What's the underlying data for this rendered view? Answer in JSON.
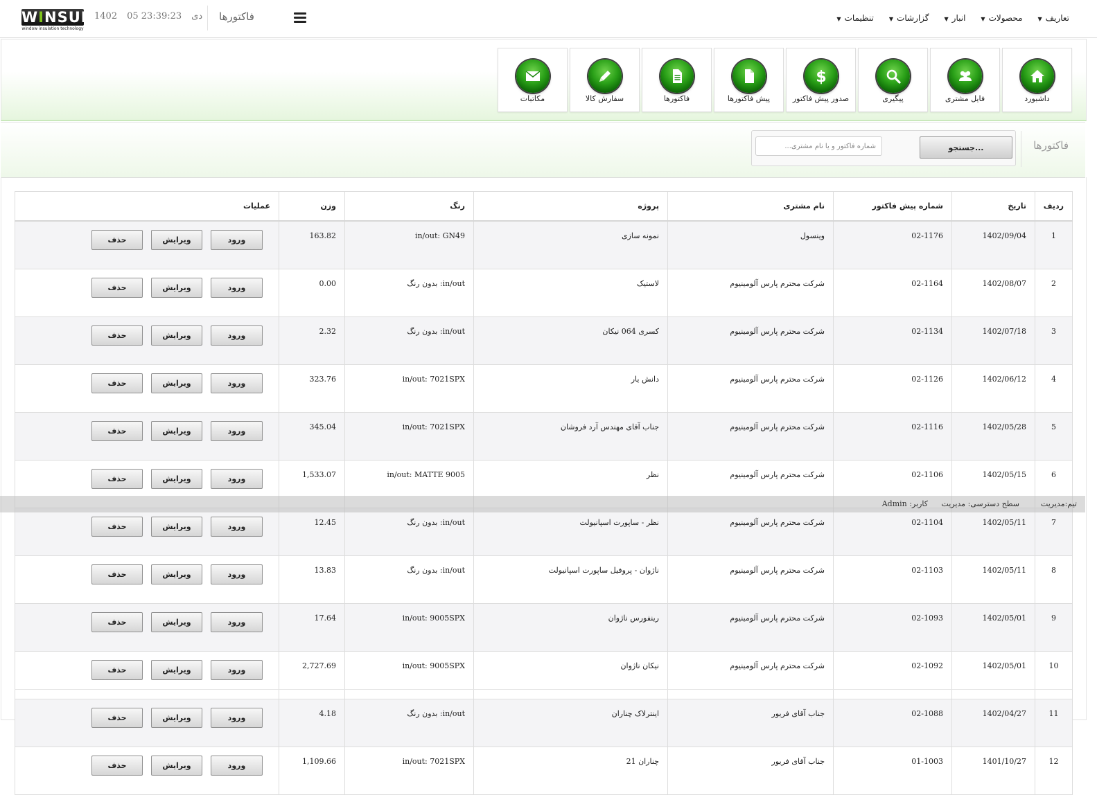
{
  "header": {
    "logo_text": "WINSUL",
    "logo_tagline": "window insulation technology",
    "clock_year": "1402",
    "clock_date": "05 دی",
    "clock_time": "23:39:23",
    "page_title": "فاکتورها",
    "menu": [
      {
        "label": "تعاریف"
      },
      {
        "label": "محصولات"
      },
      {
        "label": "انبار"
      },
      {
        "label": "گزارشات"
      },
      {
        "label": "تنظیمات"
      }
    ]
  },
  "shortcuts": [
    {
      "label": "داشبورد",
      "icon": "home-icon"
    },
    {
      "label": "فایل مشتری",
      "icon": "users-icon"
    },
    {
      "label": "پیگیری",
      "icon": "magnifier-icon"
    },
    {
      "label": "صدور پیش فاکتور",
      "icon": "dollar-icon"
    },
    {
      "label": "پیش فاکتورها",
      "icon": "document-icon"
    },
    {
      "label": "فاکتورها",
      "icon": "lined-document-icon"
    },
    {
      "label": "سفارش کالا",
      "icon": "pencil-icon"
    },
    {
      "label": "مکاتبات",
      "icon": "envelope-icon"
    }
  ],
  "search": {
    "section_title": "فاکتورها",
    "placeholder": "شماره فاکتور و یا نام مشتری...",
    "value": "",
    "button_label": "جستجو..."
  },
  "table": {
    "columns": [
      "ردیف",
      "تاریخ",
      "شماره پیش فاکتور",
      "نام مشتری",
      "پروژه",
      "رنگ",
      "وزن",
      "عملیات"
    ],
    "action_labels": {
      "enter": "ورود",
      "edit": "ویرایش",
      "delete": "حذف"
    },
    "rows": [
      {
        "num": "1",
        "date": "1402/09/04",
        "pf": "02-1176",
        "customer": "وینسول",
        "project": "نمونه سازی",
        "color": "in/out: GN49",
        "weight": "163.82"
      },
      {
        "num": "2",
        "date": "1402/08/07",
        "pf": "02-1164",
        "customer": "شرکت محترم پارس آلومینیوم",
        "project": "لاستیک",
        "color": "in/out: بدون رنگ",
        "weight": "0.00"
      },
      {
        "num": "3",
        "date": "1402/07/18",
        "pf": "02-1134",
        "customer": "شرکت محترم پارس آلومینیوم",
        "project": "کسری 064 نیکان",
        "color": "in/out: بدون رنگ",
        "weight": "2.32"
      },
      {
        "num": "4",
        "date": "1402/06/12",
        "pf": "02-1126",
        "customer": "شرکت محترم پارس آلومینیوم",
        "project": "دانش یار",
        "color": "in/out: 7021SPX",
        "weight": "323.76"
      },
      {
        "num": "5",
        "date": "1402/05/28",
        "pf": "02-1116",
        "customer": "شرکت محترم پارس آلومینیوم",
        "project": "جناب آقای مهندس آرد فروشان",
        "color": "in/out: 7021SPX",
        "weight": "345.04"
      },
      {
        "num": "6",
        "date": "1402/05/15",
        "pf": "02-1106",
        "customer": "شرکت محترم پارس آلومینیوم",
        "project": "نظر",
        "color": "in/out: MATTE 9005",
        "weight": "1,533.07"
      },
      {
        "num": "7",
        "date": "1402/05/11",
        "pf": "02-1104",
        "customer": "شرکت محترم پارس آلومینیوم",
        "project": "نظر - ساپورت اسپانیولت",
        "color": "in/out: بدون رنگ",
        "weight": "12.45"
      },
      {
        "num": "8",
        "date": "1402/05/11",
        "pf": "02-1103",
        "customer": "شرکت محترم پارس آلومینیوم",
        "project": "ناژوان - پروفیل ساپورت اسپانیولت",
        "color": "in/out: بدون رنگ",
        "weight": "13.83"
      },
      {
        "num": "9",
        "date": "1402/05/01",
        "pf": "02-1093",
        "customer": "شرکت محترم پارس آلومینیوم",
        "project": "رینفورس ناژوان",
        "color": "in/out: 9005SPX",
        "weight": "17.64"
      },
      {
        "num": "10",
        "date": "1402/05/01",
        "pf": "02-1092",
        "customer": "شرکت محترم پارس آلومینیوم",
        "project": "نیکان ناژوان",
        "color": "in/out: 9005SPX",
        "weight": "2,727.69"
      },
      {
        "num": "11",
        "date": "1402/04/27",
        "pf": "02-1088",
        "customer": "جناب آقای فریور",
        "project": "اینترلاک چناران",
        "color": "in/out: بدون رنگ",
        "weight": "4.18"
      },
      {
        "num": "12",
        "date": "1401/10/27",
        "pf": "01-1003",
        "customer": "جناب آقای فریور",
        "project": "چناران 21",
        "color": "in/out: 7021SPX",
        "weight": "1,109.66"
      }
    ]
  },
  "status": {
    "team": "تیم:مدیریت",
    "access": "سطح دسترسی: مدیریت",
    "user": "کاربر: Admin"
  },
  "colors": {
    "accent_green": "#2aa018",
    "band_green": "#e6f6de",
    "row_alt": "#f4f4f6"
  }
}
